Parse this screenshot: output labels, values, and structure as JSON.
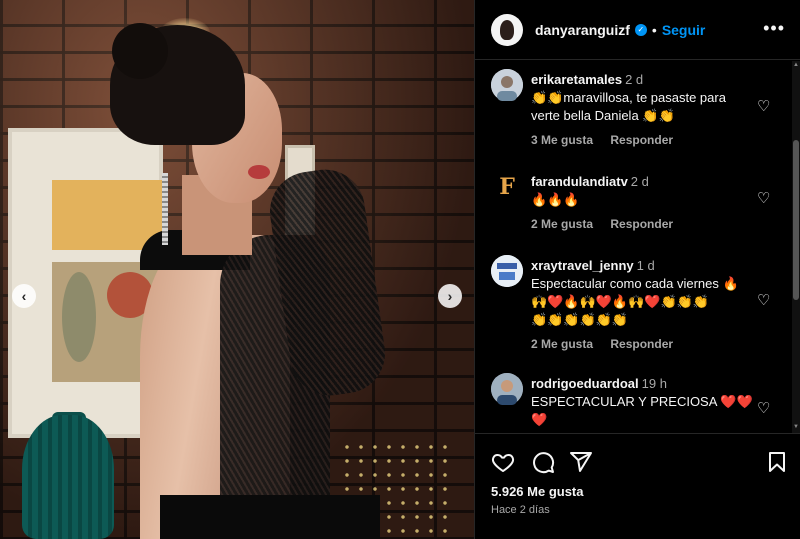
{
  "post": {
    "username": "danyaranguizf",
    "separator": "•",
    "follow_label": "Seguir",
    "more_icon": "more-options-icon",
    "more_label": "•••"
  },
  "navigation": {
    "prev_label": "‹",
    "next_label": "›"
  },
  "comments": [
    {
      "user": "erikaretamales",
      "time": "2 d",
      "text": "👏👏maravillosa, te pasaste para verte bella Daniela 👏👏",
      "likes": "3 Me gusta",
      "reply": "Responder",
      "avatar": "erika-avatar"
    },
    {
      "user": "farandulandiatv",
      "time": "2 d",
      "text": "🔥🔥🔥",
      "likes": "2 Me gusta",
      "reply": "Responder",
      "avatar_letter": "F"
    },
    {
      "user": "xraytravel_jenny",
      "time": "1 d",
      "text": "Espectacular como cada viernes 🔥",
      "text_line2": "🙌❤️🔥🙌❤️🔥🙌❤️👏👏👏",
      "text_line3": "👏👏👏👏👏👏",
      "likes": "2 Me gusta",
      "reply": "Responder",
      "avatar": "jenny-avatar"
    },
    {
      "user": "rodrigoeduardoal",
      "time": "19 h",
      "text": "ESPECTACULAR Y PRECIOSA ❤️❤️",
      "text_line2": "❤️",
      "avatar": "rodrigo-avatar"
    }
  ],
  "footer": {
    "likes": "5.926 Me gusta",
    "time_ago": "Hace 2 días"
  },
  "colors": {
    "accent": "#0095f6",
    "background": "#000000",
    "text": "#f5f5f5",
    "secondary": "#a8a8a8"
  }
}
